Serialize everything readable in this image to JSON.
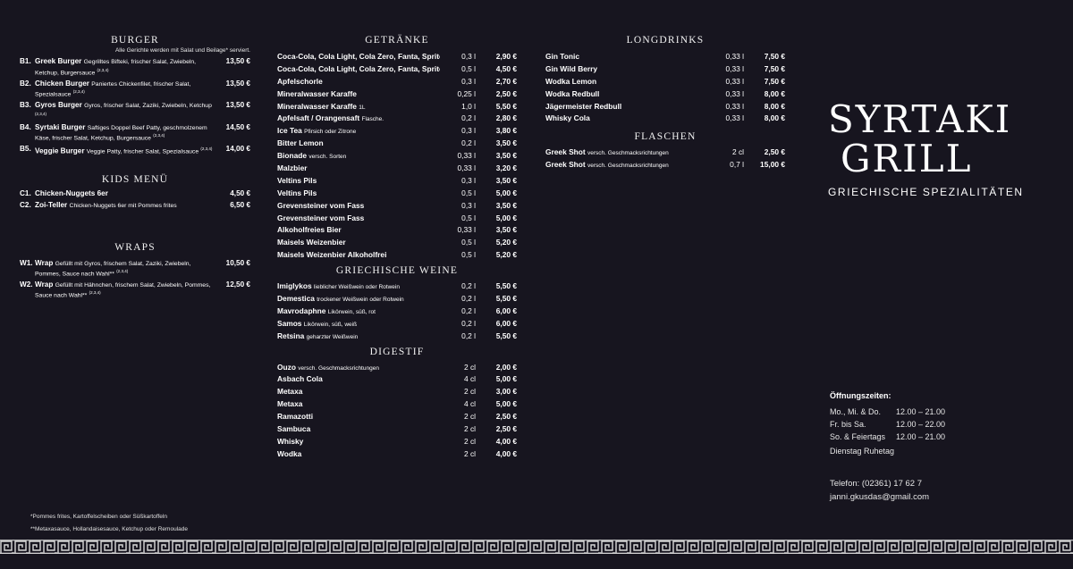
{
  "burger": {
    "title": "BURGER",
    "note": "Alle Gerichte werden mit Salat und Beilage* serviert.",
    "items": [
      {
        "code": "B1.",
        "name": "Greek Burger",
        "detail": "Gegrilltes Bifteki, frischer Salat, Zwiebeln, Ketchup, Burgersauce",
        "sup": "(2,3,4)",
        "price": "13,50 €"
      },
      {
        "code": "B2.",
        "name": "Chicken Burger",
        "detail": "Paniertes Chickenfilet, frischer Salat, Spezialsauce",
        "sup": "(2,3,4)",
        "price": "13,50 €"
      },
      {
        "code": "B3.",
        "name": "Gyros Burger",
        "detail": "Gyros, frischer Salat, Zaziki, Zwiebeln, Ketchup",
        "sup": "(2,3,4)",
        "price": "13,50 €"
      },
      {
        "code": "B4.",
        "name": "Syrtaki Burger",
        "detail": "Saftiges Doppel Beef Patty, geschmolzenem Käse, frischer Salat, Ketchup, Burgersauce",
        "sup": "(2,3,4)",
        "price": "14,50 €"
      },
      {
        "code": "B5.",
        "name": "Veggie Burger",
        "detail": "Veggie Patty, frischer Salat, Spezialsauce",
        "sup": "(2,3,4)",
        "price": "14,00 €"
      }
    ]
  },
  "kids": {
    "title": "KIDS MENÜ",
    "items": [
      {
        "code": "C1.",
        "name": "Chicken-Nuggets 6er",
        "detail": "",
        "price": "4,50 €"
      },
      {
        "code": "C2.",
        "name": "Zoi-Teller",
        "detail": "Chicken-Nuggets 6er mit Pommes frites",
        "price": "6,50 €"
      }
    ]
  },
  "wraps": {
    "title": "WRAPS",
    "items": [
      {
        "code": "W1.",
        "name": "Wrap",
        "detail": "Gefüllt mit Gyros, frischem Salat, Zaziki, Zwiebeln, Pommes, Sauce nach Wahl**",
        "sup": "(2,3,4)",
        "price": "10,50 €"
      },
      {
        "code": "W2.",
        "name": "Wrap",
        "detail": "Gefüllt mit Hähnchen, frischem Salat, Zwiebeln, Pommes, Sauce nach Wahl**",
        "sup": "(2,3,4)",
        "price": "12,50 €"
      }
    ]
  },
  "getraenke": {
    "title": "GETRÄNKE",
    "items": [
      {
        "name": "Coca-Cola, Cola Light, Cola Zero, Fanta, Sprite",
        "detail": "",
        "size": "0,3 l",
        "price": "2,90 €"
      },
      {
        "name": "Coca-Cola, Cola Light, Cola Zero, Fanta, Sprite",
        "detail": "",
        "size": "0,5 l",
        "price": "4,50 €"
      },
      {
        "name": "Apfelschorle",
        "detail": "",
        "size": "0,3 l",
        "price": "2,70 €"
      },
      {
        "name": "Mineralwasser Karaffe",
        "detail": "",
        "size": "0,25 l",
        "price": "2,50 €"
      },
      {
        "name": "Mineralwasser Karaffe",
        "detail": "1L",
        "size": "1,0 l",
        "price": "5,50 €"
      },
      {
        "name": "Apfelsaft / Orangensaft",
        "detail": "Flasche.",
        "size": "0,2 l",
        "price": "2,80 €"
      },
      {
        "name": "Ice Tea",
        "detail": "Pfirsich oder Zitrone",
        "size": "0,3 l",
        "price": "3,80 €"
      },
      {
        "name": "Bitter Lemon",
        "detail": "",
        "size": "0,2 l",
        "price": "3,50 €"
      },
      {
        "name": "Bionade",
        "detail": "versch. Sorten",
        "size": "0,33 l",
        "price": "3,50 €"
      },
      {
        "name": "Malzbier",
        "detail": "",
        "size": "0,33 l",
        "price": "3,20 €"
      },
      {
        "name": "Veltins Pils",
        "detail": "",
        "size": "0,3 l",
        "price": "3,50 €"
      },
      {
        "name": "Veltins Pils",
        "detail": "",
        "size": "0,5 l",
        "price": "5,00 €"
      },
      {
        "name": "Grevensteiner vom Fass",
        "detail": "",
        "size": "0,3 l",
        "price": "3,50 €"
      },
      {
        "name": "Grevensteiner vom Fass",
        "detail": "",
        "size": "0,5 l",
        "price": "5,00 €"
      },
      {
        "name": "Alkoholfreies Bier",
        "detail": "",
        "size": "0,33 l",
        "price": "3,50 €"
      },
      {
        "name": "Maisels Weizenbier",
        "detail": "",
        "size": "0,5 l",
        "price": "5,20 €"
      },
      {
        "name": "Maisels Weizenbier Alkoholfrei",
        "detail": "",
        "size": "0,5 l",
        "price": "5,20 €"
      }
    ]
  },
  "weine": {
    "title": "GRIECHISCHE WEINE",
    "items": [
      {
        "name": "Imiglykos",
        "detail": "lieblicher Weißwein oder Rotwein",
        "size": "0,2 l",
        "price": "5,50 €"
      },
      {
        "name": "Demestica",
        "detail": "trockener Weißwein oder Rotwein",
        "size": "0,2 l",
        "price": "5,50 €"
      },
      {
        "name": "Mavrodaphne",
        "detail": "Likörwein, süß, rot",
        "size": "0,2 l",
        "price": "6,00 €"
      },
      {
        "name": "Samos",
        "detail": "Likörwein, süß, weiß",
        "size": "0,2 l",
        "price": "6,00 €"
      },
      {
        "name": "Retsina",
        "detail": "geharzter Weißwein",
        "size": "0,2 l",
        "price": "5,50 €"
      }
    ]
  },
  "digestif": {
    "title": "DIGESTIF",
    "items": [
      {
        "name": "Ouzo",
        "detail": "versch. Geschmacksrichtungen",
        "size": "2 cl",
        "price": "2,00 €"
      },
      {
        "name": "Asbach Cola",
        "detail": "",
        "size": "4 cl",
        "price": "5,00 €"
      },
      {
        "name": "Metaxa",
        "detail": "",
        "size": "2 cl",
        "price": "3,00 €"
      },
      {
        "name": "Metaxa",
        "detail": "",
        "size": "4 cl",
        "price": "5,00 €"
      },
      {
        "name": "Ramazotti",
        "detail": "",
        "size": "2 cl",
        "price": "2,50 €"
      },
      {
        "name": "Sambuca",
        "detail": "",
        "size": "2 cl",
        "price": "2,50 €"
      },
      {
        "name": "Whisky",
        "detail": "",
        "size": "2 cl",
        "price": "4,00 €"
      },
      {
        "name": "Wodka",
        "detail": "",
        "size": "2 cl",
        "price": "4,00 €"
      }
    ]
  },
  "longdrinks": {
    "title": "LONGDRINKS",
    "items": [
      {
        "name": "Gin Tonic",
        "detail": "",
        "size": "0,33 l",
        "price": "7,50 €"
      },
      {
        "name": "Gin Wild Berry",
        "detail": "",
        "size": "0,33 l",
        "price": "7,50 €"
      },
      {
        "name": "Wodka Lemon",
        "detail": "",
        "size": "0,33 l",
        "price": "7,50 €"
      },
      {
        "name": "Wodka Redbull",
        "detail": "",
        "size": "0,33 l",
        "price": "8,00 €"
      },
      {
        "name": "Jägermeister Redbull",
        "detail": "",
        "size": "0,33 l",
        "price": "8,00 €"
      },
      {
        "name": "Whisky Cola",
        "detail": "",
        "size": "0,33 l",
        "price": "8,00 €"
      }
    ]
  },
  "flaschen": {
    "title": "FLASCHEN",
    "items": [
      {
        "name": "Greek Shot",
        "detail": "versch. Geschmacksrichtungen",
        "size": "2 cl",
        "price": "2,50 €"
      },
      {
        "name": "Greek Shot",
        "detail": "versch. Geschmacksrichtungen",
        "size": "0,7 l",
        "price": "15,00 €"
      }
    ]
  },
  "brand": {
    "line1": "SYRTAKI",
    "line2": "GRILL",
    "subtitle": "GRIECHISCHE SPEZIALITÄTEN"
  },
  "hours": {
    "title": "Öffnungszeiten:",
    "rows": [
      {
        "days": "Mo., Mi. & Do.",
        "time": "12.00 – 21.00"
      },
      {
        "days": "Fr. bis Sa.",
        "time": "12.00 – 22.00"
      },
      {
        "days": "So. & Feiertags",
        "time": "12.00 – 21.00"
      }
    ],
    "closed": "Dienstag Ruhetag"
  },
  "contact": {
    "phone": "Telefon: (02361) 17 62 7",
    "email": "janni.gkusdas@gmail.com"
  },
  "footnotes": {
    "f1": "*Pommes frites, Kartoffelscheiben oder Süßkartoffeln",
    "f2": "**Metaxasauce, Hollandaisesauce, Ketchup oder Remoulade"
  },
  "colors": {
    "background": "#17151f",
    "text": "#ffffff",
    "border_pattern": "#d9d9d9"
  }
}
